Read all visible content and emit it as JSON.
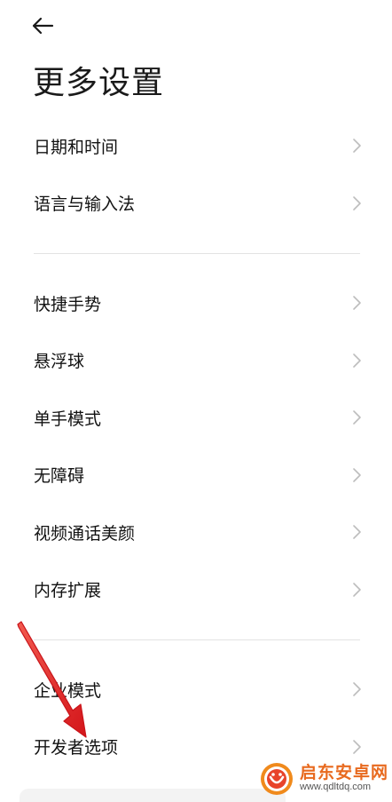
{
  "header": {
    "title": "更多设置",
    "back_icon": "arrow-left-icon"
  },
  "groups": [
    {
      "items": [
        {
          "label": "日期和时间"
        },
        {
          "label": "语言与输入法"
        }
      ]
    },
    {
      "items": [
        {
          "label": "快捷手势"
        },
        {
          "label": "悬浮球"
        },
        {
          "label": "单手模式"
        },
        {
          "label": "无障碍"
        },
        {
          "label": "视频通话美颜"
        },
        {
          "label": "内存扩展"
        }
      ]
    },
    {
      "items": [
        {
          "label": "企业模式"
        },
        {
          "label": "开发者选项"
        }
      ]
    }
  ],
  "watermark": {
    "name": "启东安卓网",
    "url": "www.qdltdq.com"
  },
  "colors": {
    "annotation_arrow": "#e8231f",
    "watermark_brand": "#e86a1f",
    "chevron": "#bdbdbd",
    "divider": "#e3e3e3"
  }
}
